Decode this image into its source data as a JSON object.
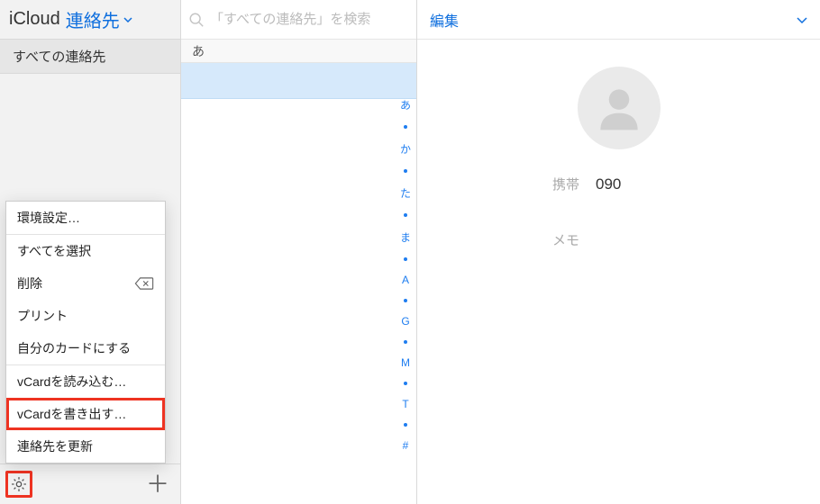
{
  "header": {
    "brand": "iCloud",
    "section": "連絡先"
  },
  "sidebar": {
    "group": "すべての連絡先"
  },
  "settingsMenu": {
    "prefs": "環境設定…",
    "selectAll": "すべてを選択",
    "delete": "削除",
    "print": "プリント",
    "makeMyCard": "自分のカードにする",
    "importVcard": "vCardを読み込む…",
    "exportVcard": "vCardを書き出す…",
    "refresh": "連絡先を更新"
  },
  "search": {
    "placeholder": "「すべての連絡先」を検索"
  },
  "list": {
    "sectionHeader": "あ"
  },
  "indexRail": [
    "あ",
    "か",
    "た",
    "ま",
    "A",
    "G",
    "M",
    "T",
    "#"
  ],
  "detail": {
    "editLabel": "編集",
    "fields": {
      "phoneLabel": "携帯",
      "phoneValue": "090",
      "memoLabel": "メモ",
      "memoValue": ""
    }
  }
}
